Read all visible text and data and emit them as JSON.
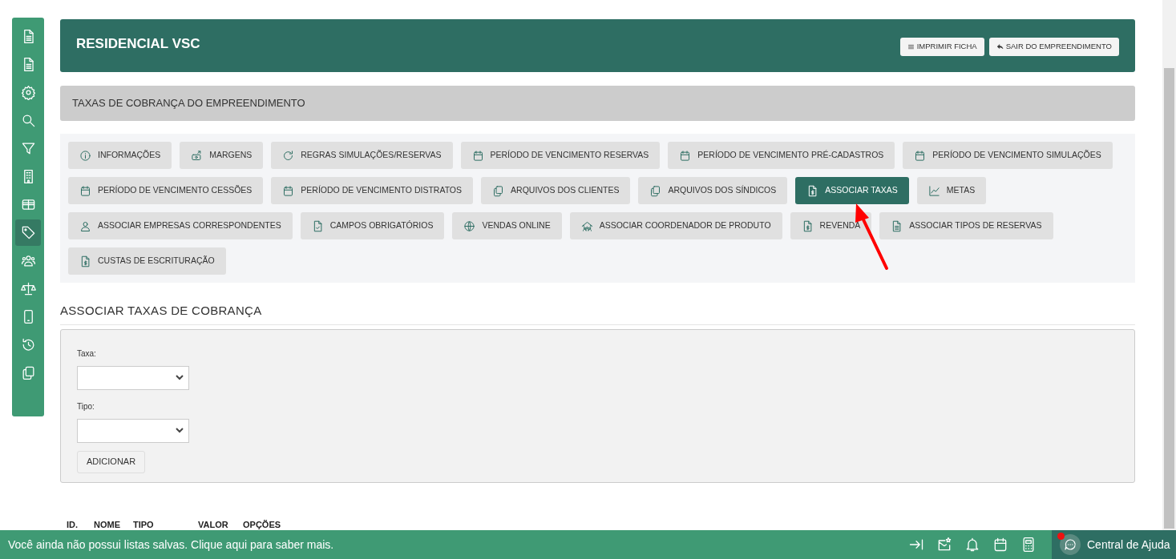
{
  "sidebar": {
    "items": [
      {
        "kind": "document",
        "selected": false
      },
      {
        "kind": "document",
        "selected": false
      },
      {
        "kind": "gear",
        "selected": false
      },
      {
        "kind": "search",
        "selected": false
      },
      {
        "kind": "filter",
        "selected": false
      },
      {
        "kind": "building",
        "selected": false
      },
      {
        "kind": "table",
        "selected": false
      },
      {
        "kind": "tag",
        "selected": true
      },
      {
        "kind": "people",
        "selected": false
      },
      {
        "kind": "scale",
        "selected": false
      },
      {
        "kind": "phone",
        "selected": false
      },
      {
        "kind": "history",
        "selected": false
      },
      {
        "kind": "copy",
        "selected": false
      }
    ]
  },
  "header": {
    "title": "RESIDENCIAL VSC",
    "buttons": [
      {
        "label": "IMPRIMIR FICHA",
        "kind": "list"
      },
      {
        "label": "SAIR DO EMPREENDIMENTO",
        "kind": "reply"
      }
    ]
  },
  "section_title": "TAXAS DE COBRANÇA DO EMPREENDIMENTO",
  "tabs": [
    {
      "label": "INFORMAÇÕES",
      "kind": "info",
      "selected": false
    },
    {
      "label": "MARGENS",
      "kind": "money",
      "selected": false
    },
    {
      "label": "REGRAS SIMULAÇÕES/RESERVAS",
      "kind": "refresh",
      "selected": false
    },
    {
      "label": "PERÍODO DE VENCIMENTO RESERVAS",
      "kind": "calendar",
      "selected": false
    },
    {
      "label": "PERÍODO DE VENCIMENTO PRÉ-CADASTROS",
      "kind": "calendar",
      "selected": false
    },
    {
      "label": "PERÍODO DE VENCIMENTO SIMULAÇÕES",
      "kind": "calendar",
      "selected": false
    },
    {
      "label": "PERÍODO DE VENCIMENTO CESSÕES",
      "kind": "calendar",
      "selected": false
    },
    {
      "label": "PERÍODO DE VENCIMENTO DISTRATOS",
      "kind": "calendar",
      "selected": false
    },
    {
      "label": "ARQUIVOS DOS CLIENTES",
      "kind": "copy",
      "selected": false
    },
    {
      "label": "ARQUIVOS DOS SÍNDICOS",
      "kind": "copy",
      "selected": false
    },
    {
      "label": "ASSOCIAR TAXAS",
      "kind": "invoice",
      "selected": true
    },
    {
      "label": "METAS",
      "kind": "chart",
      "selected": false
    },
    {
      "label": "ASSOCIAR EMPRESAS CORRESPONDENTES",
      "kind": "user",
      "selected": false
    },
    {
      "label": "CAMPOS OBRIGATÓRIOS",
      "kind": "doccheck",
      "selected": false
    },
    {
      "label": "VENDAS ONLINE",
      "kind": "globe",
      "selected": false
    },
    {
      "label": "ASSOCIAR COORDENADOR DE PRODUTO",
      "kind": "team",
      "selected": false
    },
    {
      "label": "REVENDA",
      "kind": "invoice",
      "selected": false
    },
    {
      "label": "ASSOCIAR TIPOS DE RESERVAS",
      "kind": "document",
      "selected": false
    },
    {
      "label": "CUSTAS DE ESCRITURAÇÃO",
      "kind": "invoice",
      "selected": false
    }
  ],
  "form": {
    "title": "ASSOCIAR TAXAS DE COBRANÇA",
    "fields": [
      {
        "label": "Taxa:"
      },
      {
        "label": "Tipo:"
      }
    ],
    "button": "ADICIONAR"
  },
  "table": {
    "columns": [
      "ID.",
      "NOME",
      "TIPO",
      "VALOR",
      "OPÇÕES"
    ]
  },
  "footer": {
    "message": "Você ainda não possui listas salvas. Clique aqui para saber mais.",
    "icons": [
      {
        "kind": "collapse"
      },
      {
        "kind": "mailstar"
      },
      {
        "kind": "bell"
      },
      {
        "kind": "calendar"
      },
      {
        "kind": "calculator"
      }
    ],
    "help": {
      "label": "Central de Ajuda",
      "notification": true
    }
  }
}
